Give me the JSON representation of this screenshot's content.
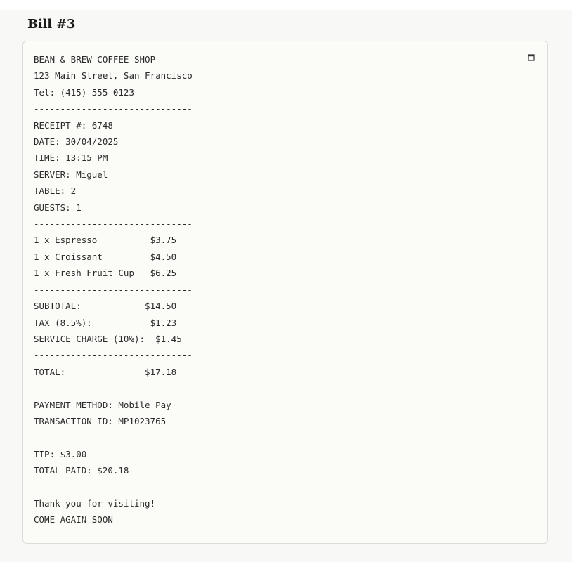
{
  "page": {
    "title": "Bill #3"
  },
  "receipt": {
    "lines": [
      "BEAN & BREW COFFEE SHOP",
      "123 Main Street, San Francisco",
      "Tel: (415) 555-0123",
      "------------------------------",
      "RECEIPT #: 6748",
      "DATE: 30/04/2025",
      "TIME: 13:15 PM",
      "SERVER: Miguel",
      "TABLE: 2",
      "GUESTS: 1",
      "------------------------------",
      "1 x Espresso          $3.75",
      "1 x Croissant         $4.50",
      "1 x Fresh Fruit Cup   $6.25",
      "------------------------------",
      "SUBTOTAL:            $14.50",
      "TAX (8.5%):           $1.23",
      "SERVICE CHARGE (10%):  $1.45",
      "------------------------------",
      "TOTAL:               $17.18",
      "",
      "PAYMENT METHOD: Mobile Pay",
      "TRANSACTION ID: MP1023765",
      "",
      "TIP: $3.00",
      "TOTAL PAID: $20.18",
      "",
      "Thank you for visiting!",
      "COME AGAIN SOON"
    ]
  },
  "icons": {
    "copy": "copy-icon"
  }
}
